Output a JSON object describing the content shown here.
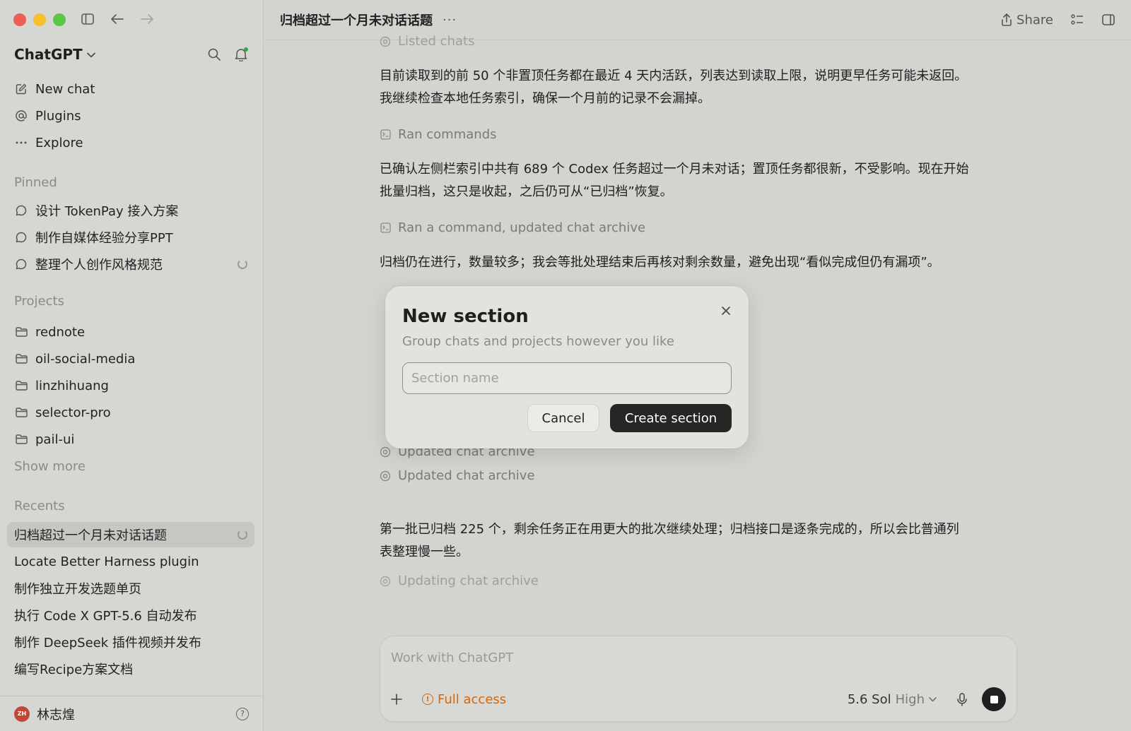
{
  "sidebar": {
    "brand": "ChatGPT",
    "nav": [
      {
        "label": "New chat",
        "icon": "compose-icon"
      },
      {
        "label": "Plugins",
        "icon": "at-icon"
      },
      {
        "label": "Explore",
        "icon": "ellipsis-icon"
      }
    ],
    "pinned_label": "Pinned",
    "pinned": [
      {
        "label": "设计 TokenPay 接入方案"
      },
      {
        "label": "制作自媒体经验分享PPT"
      },
      {
        "label": "整理个人创作风格规范"
      }
    ],
    "projects_label": "Projects",
    "projects": [
      {
        "label": "rednote"
      },
      {
        "label": "oil-social-media"
      },
      {
        "label": "linzhihuang"
      },
      {
        "label": "selector-pro"
      },
      {
        "label": "pail-ui"
      }
    ],
    "show_more": "Show more",
    "recents_label": "Recents",
    "recents": [
      {
        "label": "归档超过一个月未对话话题"
      },
      {
        "label": "Locate Better Harness plugin"
      },
      {
        "label": "制作独立开发选题单页"
      },
      {
        "label": "执行 Code X GPT-5.6 自动发布"
      },
      {
        "label": "制作 DeepSeek 插件视频并发布"
      },
      {
        "label": "编写Recipe方案文档"
      }
    ],
    "user": {
      "name": "林志煌",
      "initials": "ZH"
    }
  },
  "topbar": {
    "title": "归档超过一个月未对话话题",
    "more": "···",
    "share": "Share"
  },
  "conversation": {
    "step_listed": "Listed chats",
    "para1_line1": "目前读取到的前 50 个非置顶任务都在最近 4 天内活跃，列表达到读取上限，说明更早任务可能未返回。",
    "para1_line2": "我继续检查本地任务索引，确保一个月前的记录不会漏掉。",
    "step_ran_commands": "Ran commands",
    "para2_line1": "已确认左侧栏索引中共有 689 个 Codex 任务超过一个月未对话；置顶任务都很新，不受影响。现在开始",
    "para2_line2": "批量归档，这只是收起，之后仍可从“已归档”恢复。",
    "step_ran_updated": "Ran a command, updated chat archive",
    "para3": "归档仍在进行，数量较多；我会等批处理结束后再核对剩余数量，避免出现“看似完成但仍有漏项”。",
    "step_updated_1": "Updated chat archive",
    "step_updated_2": "Updated chat archive",
    "para4_line1": "第一批已归档 225 个，剩余任务正在用更大的批次继续处理；归档接口是逐条完成的，所以会比普通列",
    "para4_line2": "表整理慢一些。",
    "step_updating": "Updating chat archive"
  },
  "composer": {
    "placeholder": "Work with ChatGPT",
    "access": "Full access",
    "model": "5.6 Sol",
    "level": "High",
    "access_color": "#d3670c"
  },
  "modal": {
    "title": "New section",
    "subtitle": "Group chats and projects however you like",
    "input_placeholder": "Section name",
    "input_value": "",
    "cancel": "Cancel",
    "create": "Create section"
  }
}
